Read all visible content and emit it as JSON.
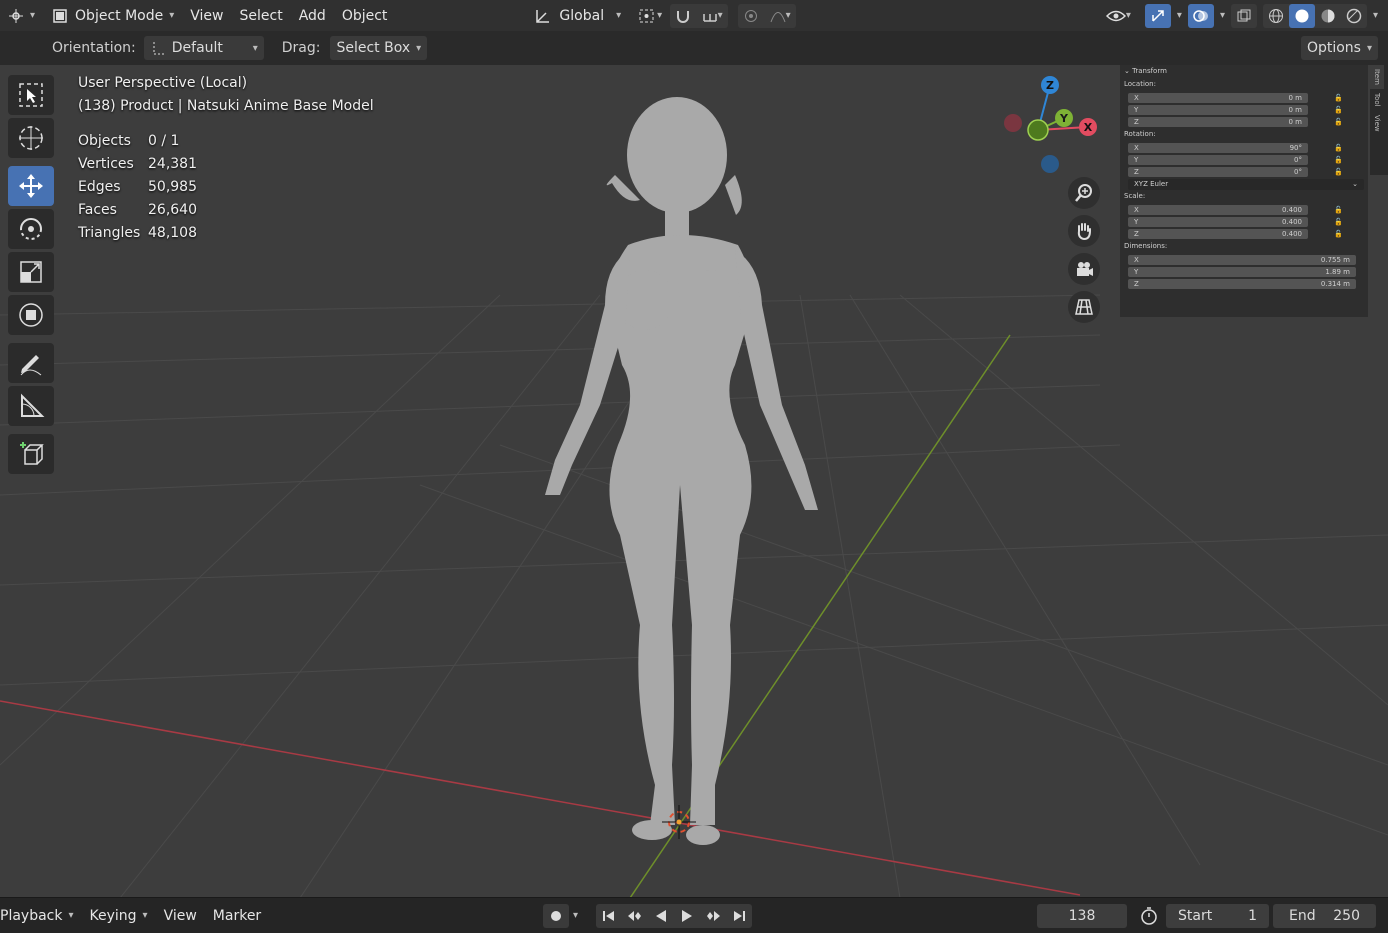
{
  "header": {
    "mode_label": "Object Mode",
    "menus": [
      "View",
      "Select",
      "Add",
      "Object"
    ],
    "transform_orientation": "Global"
  },
  "toolsettings": {
    "orientation_label": "Orientation:",
    "orientation_value": "Default",
    "drag_label": "Drag:",
    "drag_value": "Select Box",
    "options_label": "Options"
  },
  "overlay": {
    "view_name": "User Perspective (Local)",
    "object_info": "(138) Product | Natsuki Anime Base Model",
    "stats": [
      {
        "key": "Objects",
        "value": "0 / 1"
      },
      {
        "key": "Vertices",
        "value": "24,381"
      },
      {
        "key": "Edges",
        "value": "50,985"
      },
      {
        "key": "Faces",
        "value": "26,640"
      },
      {
        "key": "Triangles",
        "value": "48,108"
      }
    ]
  },
  "gizmo": {
    "x": "X",
    "y": "Y",
    "z": "Z"
  },
  "npanel": {
    "panel_title": "Transform",
    "location_label": "Location:",
    "location": [
      {
        "axis": "X",
        "value": "0 m"
      },
      {
        "axis": "Y",
        "value": "0 m"
      },
      {
        "axis": "Z",
        "value": "0 m"
      }
    ],
    "rotation_label": "Rotation:",
    "rotation": [
      {
        "axis": "X",
        "value": "90°"
      },
      {
        "axis": "Y",
        "value": "0°"
      },
      {
        "axis": "Z",
        "value": "0°"
      }
    ],
    "rotation_mode": "XYZ Euler",
    "scale_label": "Scale:",
    "scale": [
      {
        "axis": "X",
        "value": "0.400"
      },
      {
        "axis": "Y",
        "value": "0.400"
      },
      {
        "axis": "Z",
        "value": "0.400"
      }
    ],
    "dimensions_label": "Dimensions:",
    "dimensions": [
      {
        "axis": "X",
        "value": "0.755 m"
      },
      {
        "axis": "Y",
        "value": "1.89 m"
      },
      {
        "axis": "Z",
        "value": "0.314 m"
      }
    ],
    "tabs": [
      "Item",
      "Tool",
      "View"
    ]
  },
  "timeline": {
    "menus": [
      "Playback",
      "Keying",
      "View",
      "Marker"
    ],
    "current_frame": "138",
    "start_label": "Start",
    "start_value": "1",
    "end_label": "End",
    "end_value": "250"
  },
  "colors": {
    "accent": "#4772b3",
    "x_axis": "#e24c60",
    "y_axis": "#7eb235",
    "z_axis": "#2f86d6"
  }
}
